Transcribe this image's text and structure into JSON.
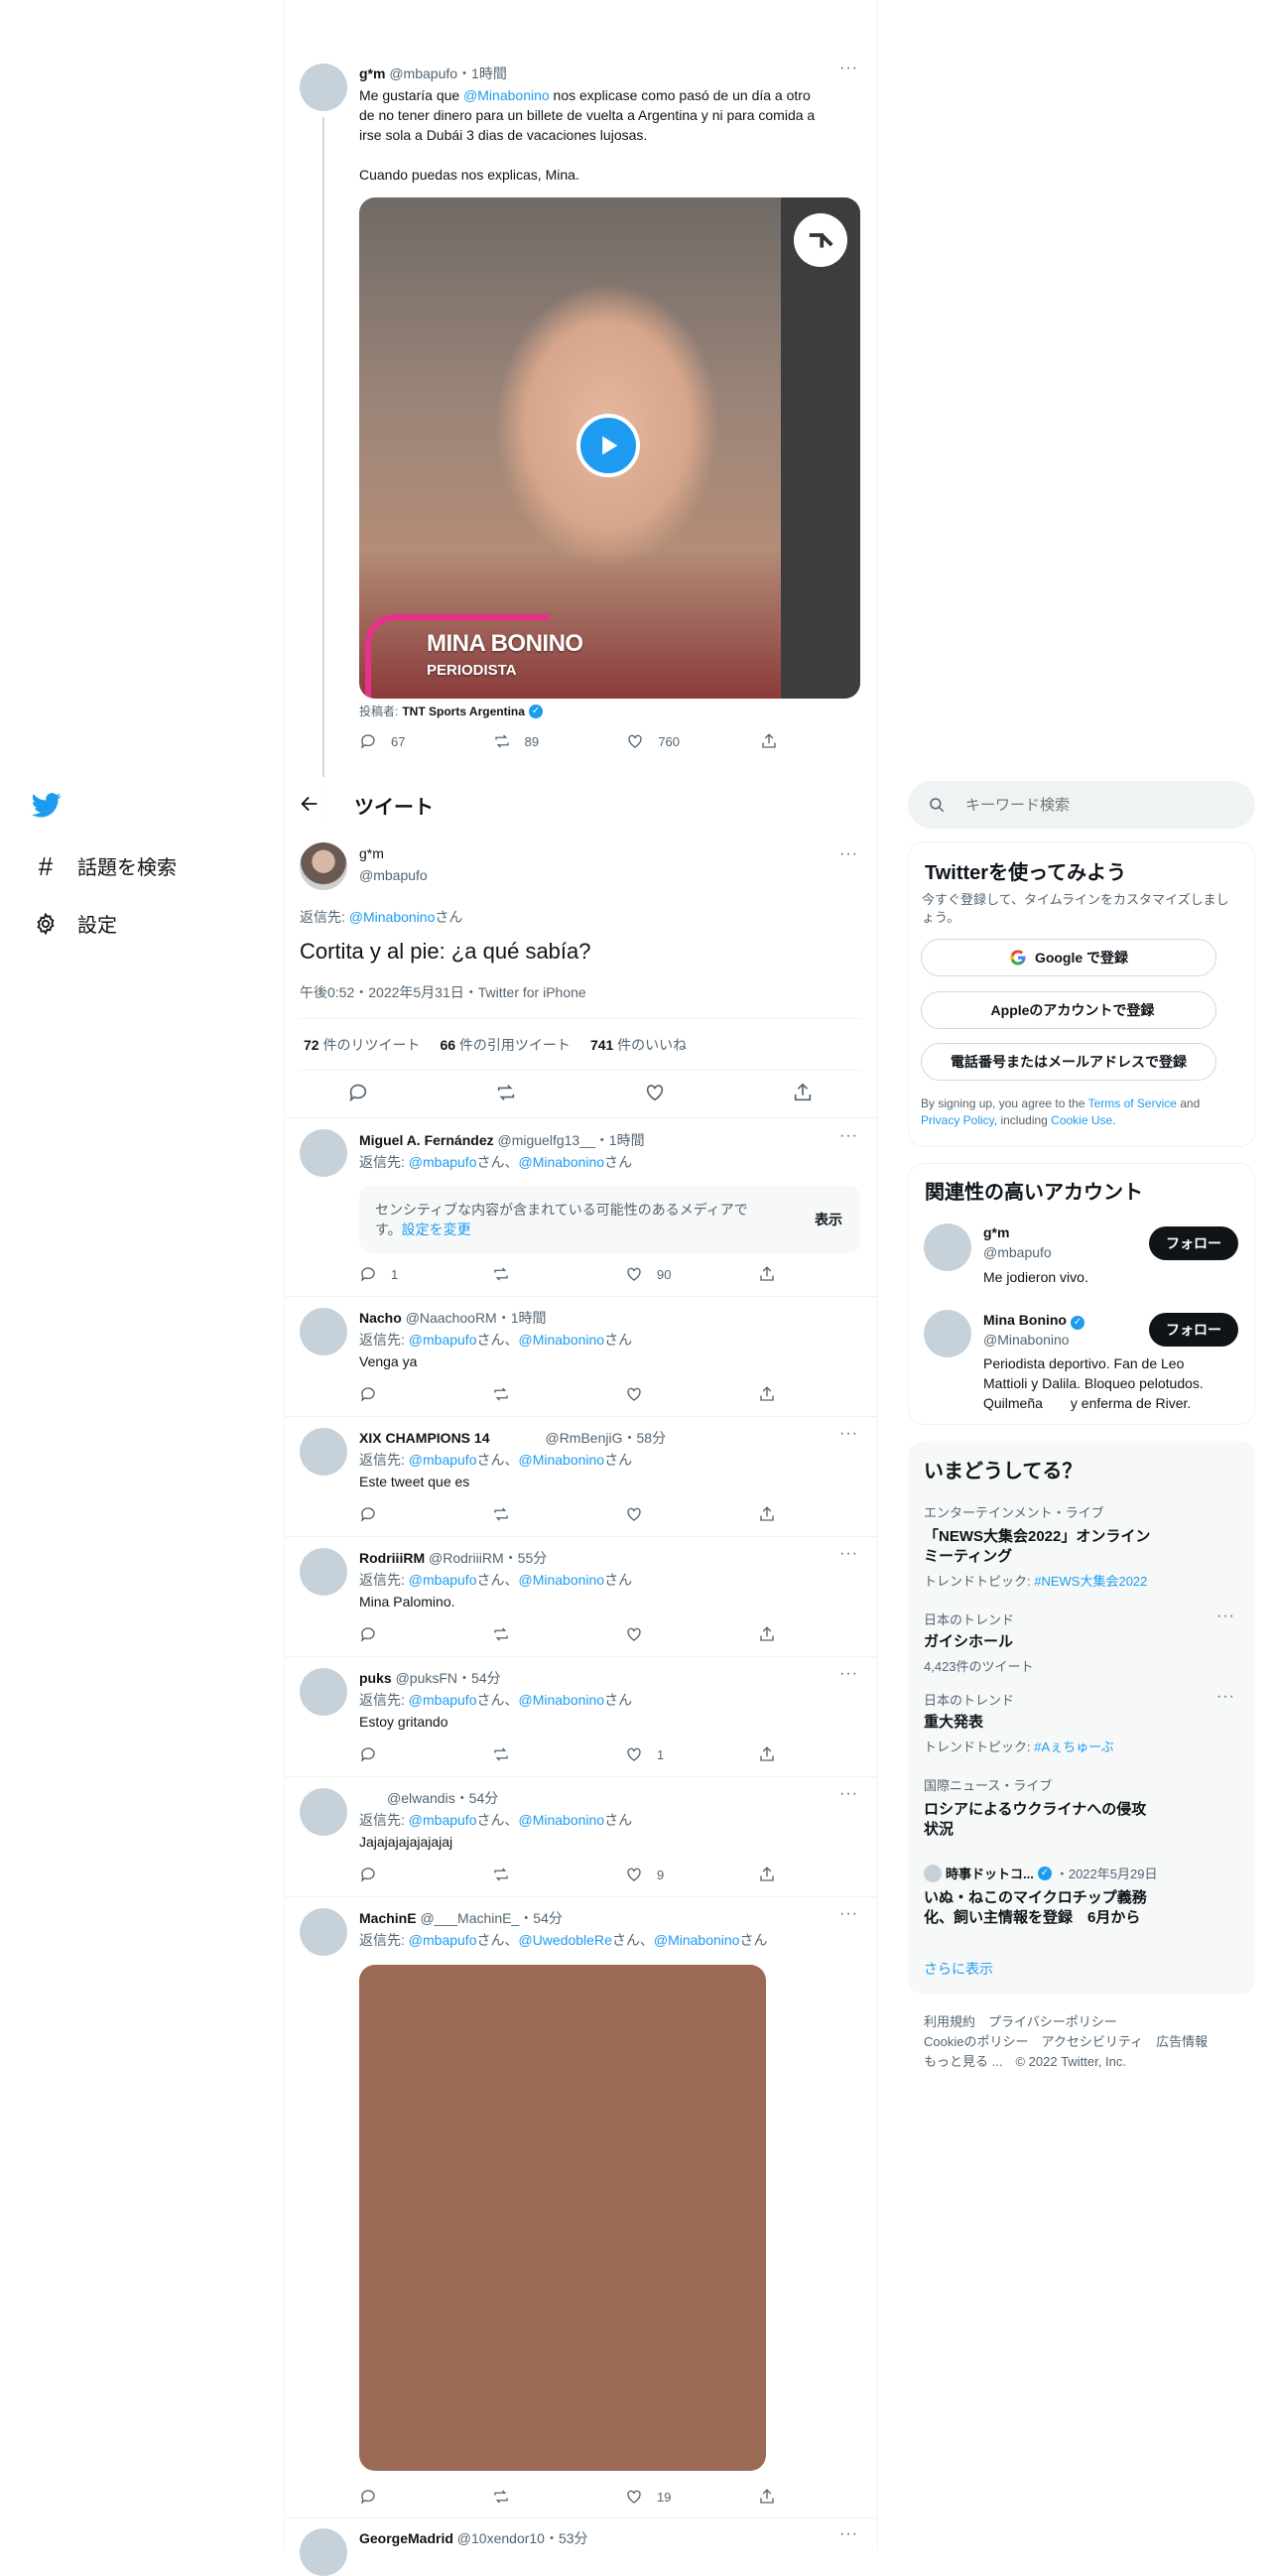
{
  "nav": {
    "explore_label": "話題を検索",
    "settings_label": "設定"
  },
  "header": {
    "title": "ツイート"
  },
  "prev_tweet": {
    "name": "g*m",
    "handle": "@mbapufo",
    "time": "1時間",
    "text_line1_pre": "Me gustaría que ",
    "mention": "@Minabonino",
    "text_line1_post": " nos explicase como pasó de un día a otro",
    "text_line2": "de no tener dinero para un billete de vuelta a Argentina y ni para comida a",
    "text_line3": "irse sola a Dubái 3 dias de vacaciones lujosas.",
    "text_line4": "Cuando puedas nos explicas, Mina.",
    "video_name": "MINA BONINO",
    "video_role": "PERIODISTA",
    "posted_by_label": "投稿者:",
    "posted_by": "TNT Sports Argentina",
    "replies": "67",
    "retweets": "89",
    "likes": "760"
  },
  "main_tweet": {
    "name": "g*m",
    "handle": "@mbapufo",
    "reply_to_label": "返信先: ",
    "reply_to": "@Minabonino",
    "reply_suffix": "さん",
    "text": "Cortita y al pie: ¿a qué sabía?",
    "meta": "午後0:52・2022年5月31日・Twitter for iPhone",
    "retweet_count": "72",
    "retweet_label": " 件のリツイート",
    "quote_count": "66",
    "quote_label": " 件の引用ツイート",
    "like_count": "741",
    "like_label": " 件のいいね"
  },
  "replies": [
    {
      "name": "Miguel A. Fernández",
      "handle": "@miguelfg13__",
      "time": "・1時間",
      "reply_to": "返信先: ",
      "m1": "@mbapufo",
      "sep1": "さん、",
      "m2": "@Minabonino",
      "sep2": "さん",
      "text": "",
      "sensitive_text_line1": "センシティブな内容が含まれている可能性のあるメディアで",
      "sensitive_text_line2": "す。",
      "sensitive_link": "設定を変更",
      "show_label": "表示",
      "replies": "1",
      "retweets": "",
      "likes": "90"
    },
    {
      "name": "Nacho",
      "handle": "@NaachooRM",
      "time": "・1時間",
      "reply_to": "返信先: ",
      "m1": "@mbapufo",
      "sep1": "さん、",
      "m2": "@Minabonino",
      "sep2": "さん",
      "text": "Venga ya",
      "replies": "",
      "retweets": "",
      "likes": ""
    },
    {
      "name": "XIX CHAMPIONS 14",
      "handle": "@RmBenjiG",
      "time": "・58分",
      "reply_to": "返信先: ",
      "m1": "@mbapufo",
      "sep1": "さん、",
      "m2": "@Minabonino",
      "sep2": "さん",
      "text": "Este tweet que es",
      "replies": "",
      "retweets": "",
      "likes": ""
    },
    {
      "name": "RodriiiRM",
      "handle": "@RodriiiRM",
      "time": "・55分",
      "reply_to": "返信先: ",
      "m1": "@mbapufo",
      "sep1": "さん、",
      "m2": "@Minabonino",
      "sep2": "さん",
      "text": "Mina Palomino.",
      "replies": "",
      "retweets": "",
      "likes": ""
    },
    {
      "name": "puks",
      "handle": "@puksFN",
      "time": "・54分",
      "reply_to": "返信先: ",
      "m1": "@mbapufo",
      "sep1": "さん、",
      "m2": "@Minabonino",
      "sep2": "さん",
      "text": "Estoy gritando",
      "replies": "",
      "retweets": "",
      "likes": "1"
    },
    {
      "name": "",
      "handle": "@elwandis",
      "time": "・54分",
      "reply_to": "返信先: ",
      "m1": "@mbapufo",
      "sep1": "さん、",
      "m2": "@Minabonino",
      "sep2": "さん",
      "text": "Jajajajajajajajaj",
      "replies": "",
      "retweets": "",
      "likes": "9"
    },
    {
      "name": "MachinE",
      "handle": "@___MachinE_",
      "time": "・54分",
      "reply_to": "返信先: ",
      "m1": "@mbapufo",
      "sep1": "さん、",
      "m2": "@UwedobleRe",
      "sep2": "さん、",
      "m3": "@Minabonino",
      "sep3": "さん",
      "text": "",
      "replies": "",
      "retweets": "",
      "likes": "19"
    },
    {
      "name": "GeorgeMadrid",
      "handle": "@10xendor10",
      "time": "・53分"
    }
  ],
  "sidebar": {
    "search_placeholder": "キーワード検索",
    "signup": {
      "title": "Twitterを使ってみよう",
      "desc_line1": "今すぐ登録して、タイムラインをカスタマイズしまし",
      "desc_line2": "ょう。",
      "google": "Google で登録",
      "apple": "Appleのアカウントで登録",
      "phone": "電話番号またはメールアドレスで登録",
      "terms_pre": "By signing up, you agree to the ",
      "terms": "Terms of Service",
      "terms_and": " and",
      "privacy": "Privacy Policy",
      "terms_mid": ", including ",
      "cookie": "Cookie Use",
      "terms_end": "."
    },
    "related": {
      "title": "関連性の高いアカウント",
      "accounts": [
        {
          "name": "g*m",
          "handle": "@mbapufo",
          "bio_line1": "Me jodieron vivo.",
          "bio_line2": "",
          "bio_line3": "",
          "follow": "フォロー"
        },
        {
          "name": "Mina Bonino",
          "handle": "@Minabonino",
          "bio_line1": "Periodista deportivo. Fan de Leo",
          "bio_line2": "Mattioli y Dalila. Bloqueo pelotudos.",
          "bio_line3": "Quilmeña　　y enferma de River.",
          "follow": "フォロー"
        }
      ]
    },
    "trends": {
      "title": "いまどうしてる？",
      "items": [
        {
          "context": "エンターテインメント・ライブ",
          "title_line1": "「NEWS大集会2022」オンライン",
          "title_line2": "ミーティング",
          "sub_label": "トレンドトピック: ",
          "sub_link": "#NEWS大集会2022"
        },
        {
          "context": "日本のトレンド",
          "title_line1": "ガイシホール",
          "title_line2": "",
          "sub_label": "4,423件のツイート",
          "sub_link": ""
        },
        {
          "context": "日本のトレンド",
          "title_line1": "重大発表",
          "title_line2": "",
          "sub_label": "トレンドトピック: ",
          "sub_link": "#Aぇちゅーぶ"
        },
        {
          "context": "国際ニュース・ライブ",
          "title_line1": "ロシアによるウクライナへの侵攻",
          "title_line2": "状況",
          "sub_label": "",
          "sub_link": ""
        }
      ],
      "news": {
        "source": "時事ドットコ...",
        "date": "・2022年5月29日",
        "title_line1": "いぬ・ねこのマイクロチップ義務",
        "title_line2": "化、飼い主情報を登録　6月から"
      },
      "show_more": "さらに表示"
    },
    "footer": {
      "l1a": "利用規約",
      "l1b": "プライバシーポリシー",
      "l2a": "Cookieのポリシー",
      "l2b": "アクセシビリティ",
      "l2c": "広告情報",
      "l3a": "もっと見る ...",
      "l3b": "© 2022 Twitter, Inc."
    }
  },
  "colors": {
    "accent": "#1d9bf0",
    "text": "#0f1419",
    "muted": "#536471",
    "video_bg_color": "#9a6a54"
  }
}
